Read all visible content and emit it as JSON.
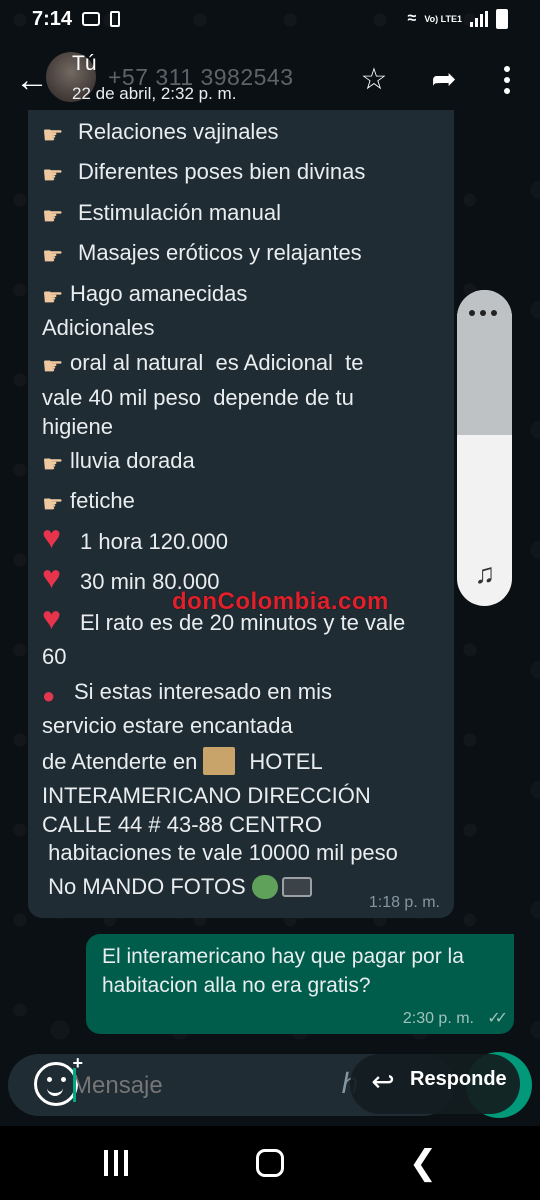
{
  "status_bar": {
    "time": "7:14",
    "lte": "Vo) LTE1",
    "battery": "100"
  },
  "header": {
    "contact_name": "Tú",
    "phone": "+57 311 3982543",
    "date": "22 de abril, 2:32 p. m."
  },
  "received_message": {
    "lines": [
      "Relaciones vajinales",
      "Diferentes poses bien divinas",
      "Estimulación manual",
      "Masajes eróticos y relajantes",
      "Hago amanecidas",
      "Adicionales",
      "oral al natural  es Adicional  te",
      "vale 40 mil peso  depende de tu",
      "higiene",
      "lluvia dorada",
      "fetiche",
      "1 hora 120.000",
      "30 min 80.000",
      "El rato es de 20 minutos y te vale",
      "60",
      "Si estas interesado en mis",
      "servicio estare encantada",
      "de Atenderte en",
      "HOTEL",
      "INTERAMERICANO DIRECCIÓN",
      "CALLE 44 # 43-88 CENTRO",
      " habitaciones te vale 10000 mil peso",
      " No MANDO FOTOS"
    ],
    "time": "1:18 p. m."
  },
  "sent_message": {
    "text": "El interamericano hay que pagar por la habitacion alla no era gratis?",
    "time": "2:30 p. m.",
    "ticks": "✓✓"
  },
  "watermark": "donColombia.com",
  "input": {
    "placeholder": "Mensaje"
  },
  "reply_chip": {
    "label": "Responde"
  },
  "colors": {
    "background": "#0b1014",
    "incoming_bubble": "#1f2c34",
    "outgoing_bubble": "#005c4b",
    "accent": "#00a884",
    "watermark": "#e0202a"
  },
  "volume": {
    "level_fraction": 0.54
  }
}
